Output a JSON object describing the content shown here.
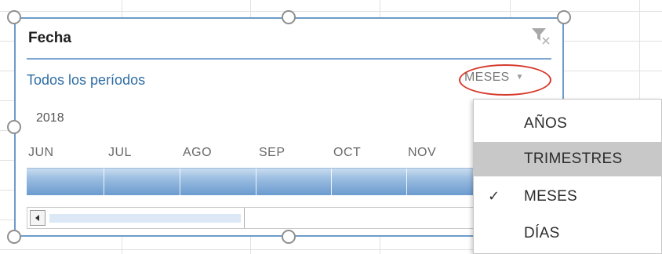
{
  "slicer": {
    "title": "Fecha",
    "period_label": "Todos los períodos",
    "level": "MESES",
    "year": "2018",
    "months": [
      "JUN",
      "JUL",
      "AGO",
      "SEP",
      "OCT",
      "NOV"
    ]
  },
  "menu": {
    "items": [
      {
        "label": "AÑOS",
        "checked": false,
        "highlighted": false
      },
      {
        "label": "TRIMESTRES",
        "checked": false,
        "highlighted": true
      },
      {
        "label": "MESES",
        "checked": true,
        "highlighted": false
      },
      {
        "label": "DÍAS",
        "checked": false,
        "highlighted": false
      }
    ],
    "check_mark": "✓"
  },
  "colors": {
    "accent_blue": "#2f6da3",
    "timeline_bar": "#6b9bcf",
    "annotation_red": "#d63a2c",
    "menu_highlight": "#c8c8c8"
  },
  "icons": {
    "clear_filter": "clear-filter-icon",
    "dropdown": "chevron-down-icon",
    "scroll_left": "arrow-left-icon"
  }
}
